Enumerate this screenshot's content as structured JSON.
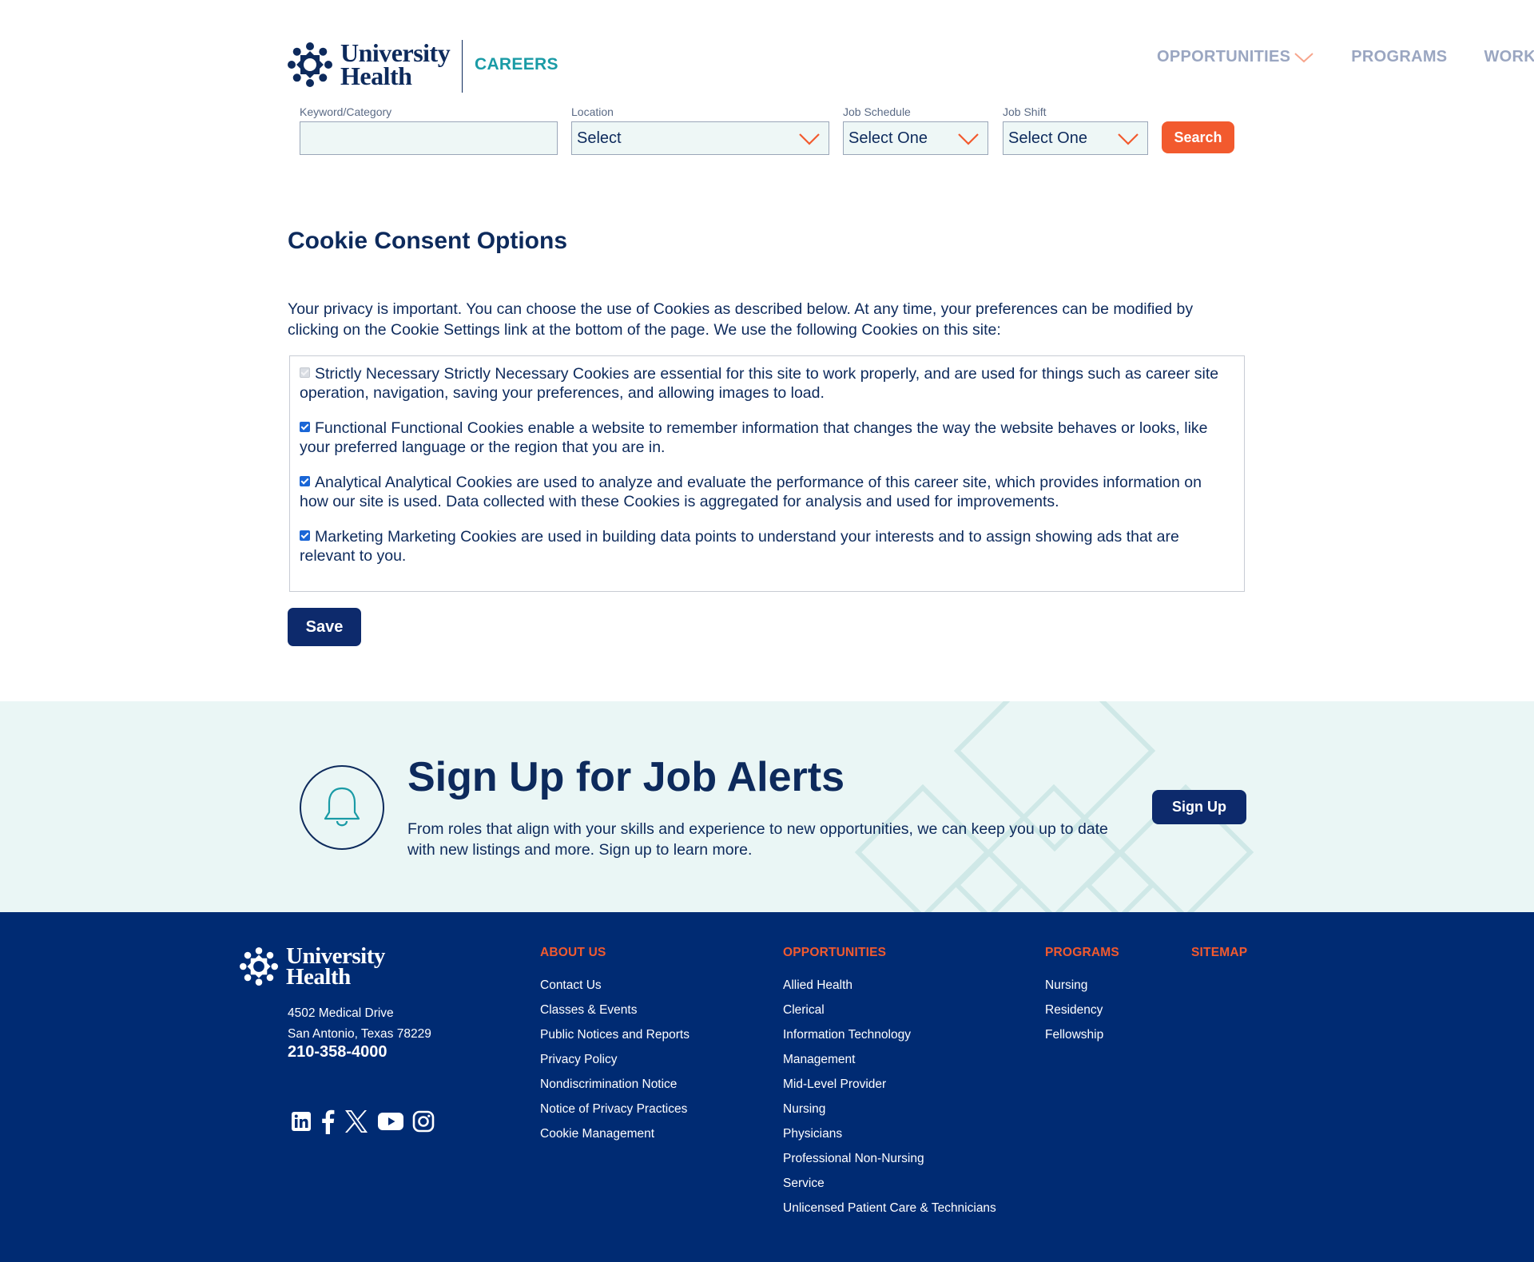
{
  "brand": {
    "line1": "University",
    "line2": "Health",
    "careers": "CAREERS"
  },
  "nav": {
    "items": [
      "OPPORTUNITIES",
      "PROGRAMS",
      "WORKIN"
    ]
  },
  "search": {
    "keyword_label": "Keyword/Category",
    "keyword_value": "",
    "location_label": "Location",
    "location_value": "Select",
    "schedule_label": "Job Schedule",
    "schedule_value": "Select One",
    "shift_label": "Job Shift",
    "shift_value": "Select One",
    "button": "Search"
  },
  "cookie": {
    "title": "Cookie Consent Options",
    "intro": "Your privacy is important. You can choose the use of Cookies as described below. At any time, your preferences can be modified by clicking on the Cookie Settings link at the bottom of the page. We use the following Cookies on this site:",
    "options": [
      {
        "name": "Strictly Necessary",
        "text": "Strictly Necessary Cookies are essential for this site to work properly, and are used for things such as career site operation, navigation, saving your preferences, and allowing images to load.",
        "checked": true,
        "disabled": true
      },
      {
        "name": "Functional",
        "text": "Functional Cookies enable a website to remember information that changes the way the website behaves or looks, like your preferred language or the region that you are in.",
        "checked": true,
        "disabled": false
      },
      {
        "name": "Analytical",
        "text": "Analytical Cookies are used to analyze and evaluate the performance of this career site, which provides information on how our site is used. Data collected with these Cookies is aggregated for analysis and used for improvements.",
        "checked": true,
        "disabled": false
      },
      {
        "name": "Marketing",
        "text": "Marketing Cookies are used in building data points to understand your interests and to assign showing ads that are relevant to you.",
        "checked": true,
        "disabled": false
      }
    ],
    "save": "Save"
  },
  "alerts": {
    "title": "Sign Up for Job Alerts",
    "text": "From roles that align with your skills and experience to new opportunities, we can keep you up to date with new listings and more. Sign up to learn more.",
    "button": "Sign Up"
  },
  "footer": {
    "address1": "4502 Medical Drive",
    "address2": "San Antonio, Texas 78229",
    "phone": "210-358-4000",
    "social": [
      "linkedin-icon",
      "facebook-icon",
      "x-icon",
      "youtube-icon",
      "instagram-icon"
    ],
    "columns": [
      {
        "title": "ABOUT US",
        "links": [
          "Contact Us",
          "Classes & Events",
          "Public Notices and Reports",
          "Privacy Policy",
          "Nondiscrimination Notice",
          "Notice of Privacy Practices",
          "Cookie Management"
        ]
      },
      {
        "title": "OPPORTUNITIES",
        "links": [
          "Allied Health",
          "Clerical",
          "Information Technology",
          "Management",
          "Mid-Level Provider",
          "Nursing",
          "Physicians",
          "Professional Non-Nursing",
          "Service",
          "Unlicensed Patient Care & Technicians"
        ]
      },
      {
        "title": "PROGRAMS",
        "links": [
          "Nursing",
          "Residency",
          "Fellowship"
        ]
      },
      {
        "title": "SITEMAP",
        "links": []
      }
    ]
  },
  "colors": {
    "navy": "#0d2a5c",
    "teal": "#1a9ba6",
    "orange": "#f25a2e",
    "footer_bg": "#002b73",
    "alerts_bg": "#eaf6f5"
  }
}
